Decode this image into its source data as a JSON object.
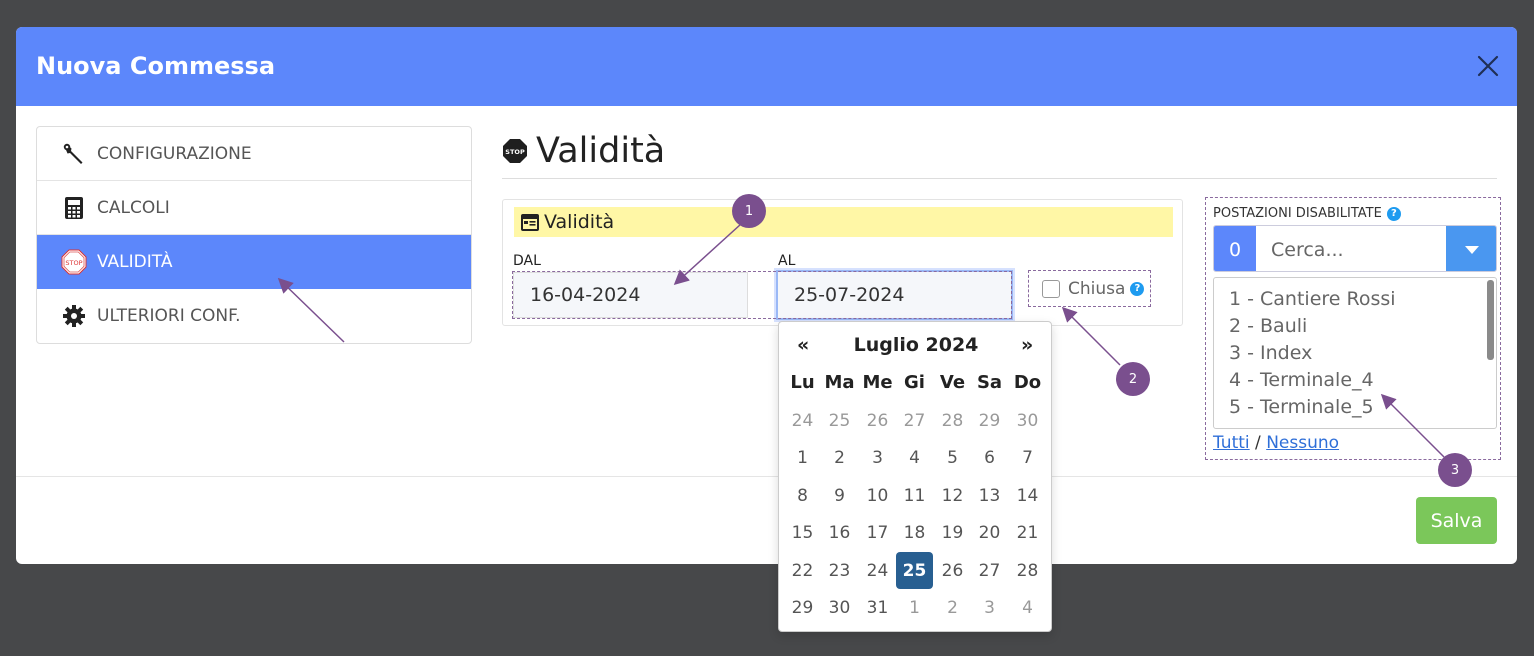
{
  "modal": {
    "title": "Nuova Commessa"
  },
  "sidebar": {
    "items": [
      {
        "label": "CONFIGURAZIONE",
        "icon": "wrench-icon"
      },
      {
        "label": "CALCOLI",
        "icon": "calculator-icon"
      },
      {
        "label": "VALIDITÀ",
        "icon": "stop-sign-icon",
        "active": true
      },
      {
        "label": "ULTERIORI CONF.",
        "icon": "gear-icon"
      }
    ]
  },
  "section": {
    "title": "Validità"
  },
  "panel": {
    "header": "Validità",
    "dal_label": "DAL",
    "dal_value": "16-04-2024",
    "al_label": "AL",
    "al_value": "25-07-2024",
    "closed_label": "Chiusa"
  },
  "postazioni": {
    "title": "POSTAZIONI DISABILITATE",
    "count": "0",
    "search_placeholder": "Cerca...",
    "items": [
      "1 - Cantiere Rossi",
      "2 - Bauli",
      "3 - Index",
      "4 - Terminale_4",
      "5 - Terminale_5"
    ],
    "all_link": "Tutti",
    "separator": "/",
    "none_link": "Nessuno"
  },
  "footer": {
    "save_label": "Salva"
  },
  "datepicker": {
    "month": "Luglio 2024",
    "prev": "«",
    "next": "»",
    "weekdays": [
      "Lu",
      "Ma",
      "Me",
      "Gi",
      "Ve",
      "Sa",
      "Do"
    ],
    "weeks": [
      [
        "24",
        "25",
        "26",
        "27",
        "28",
        "29",
        "30"
      ],
      [
        "1",
        "2",
        "3",
        "4",
        "5",
        "6",
        "7"
      ],
      [
        "8",
        "9",
        "10",
        "11",
        "12",
        "13",
        "14"
      ],
      [
        "15",
        "16",
        "17",
        "18",
        "19",
        "20",
        "21"
      ],
      [
        "22",
        "23",
        "24",
        "25",
        "26",
        "27",
        "28"
      ],
      [
        "29",
        "30",
        "31",
        "1",
        "2",
        "3",
        "4"
      ]
    ],
    "selected": "25"
  },
  "markers": [
    "1",
    "2",
    "3"
  ],
  "colors": {
    "header": "#5c87fb",
    "active_nav": "#5c87fb",
    "save": "#7bc75a",
    "selected_day": "#285f91",
    "marker": "#7a4f8e"
  }
}
